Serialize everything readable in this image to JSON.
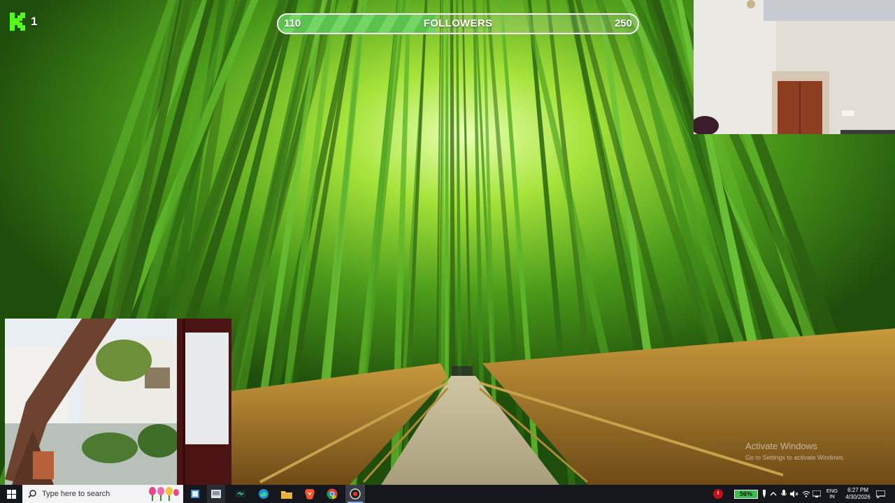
{
  "overlay": {
    "kick_count": "1",
    "followers": {
      "current": "110",
      "label": "FOLLOWERS",
      "target": "250",
      "progress_fraction": 0.44
    }
  },
  "watermark": {
    "title": "Activate Windows",
    "subtitle": "Go to Settings to activate Windows."
  },
  "taskbar": {
    "search_placeholder": "Type here to search",
    "battery_percent": "56%",
    "language": {
      "line1": "ENG",
      "line2": "IN"
    },
    "clock": {
      "time": "6:27 PM",
      "date": "4/30/2026"
    },
    "pinned_apps": [
      "task-view-icon",
      "file-explorer-icon",
      "media-player-icon",
      "edge-browser-icon",
      "folder-icon",
      "brave-browser-icon",
      "chrome-browser-icon",
      "screen-recorder-icon"
    ]
  },
  "colors": {
    "kick_green": "#53fc18",
    "followers_fill": "#5cc24e",
    "taskbar": "#15171c",
    "battery": "#3dbd4f"
  }
}
